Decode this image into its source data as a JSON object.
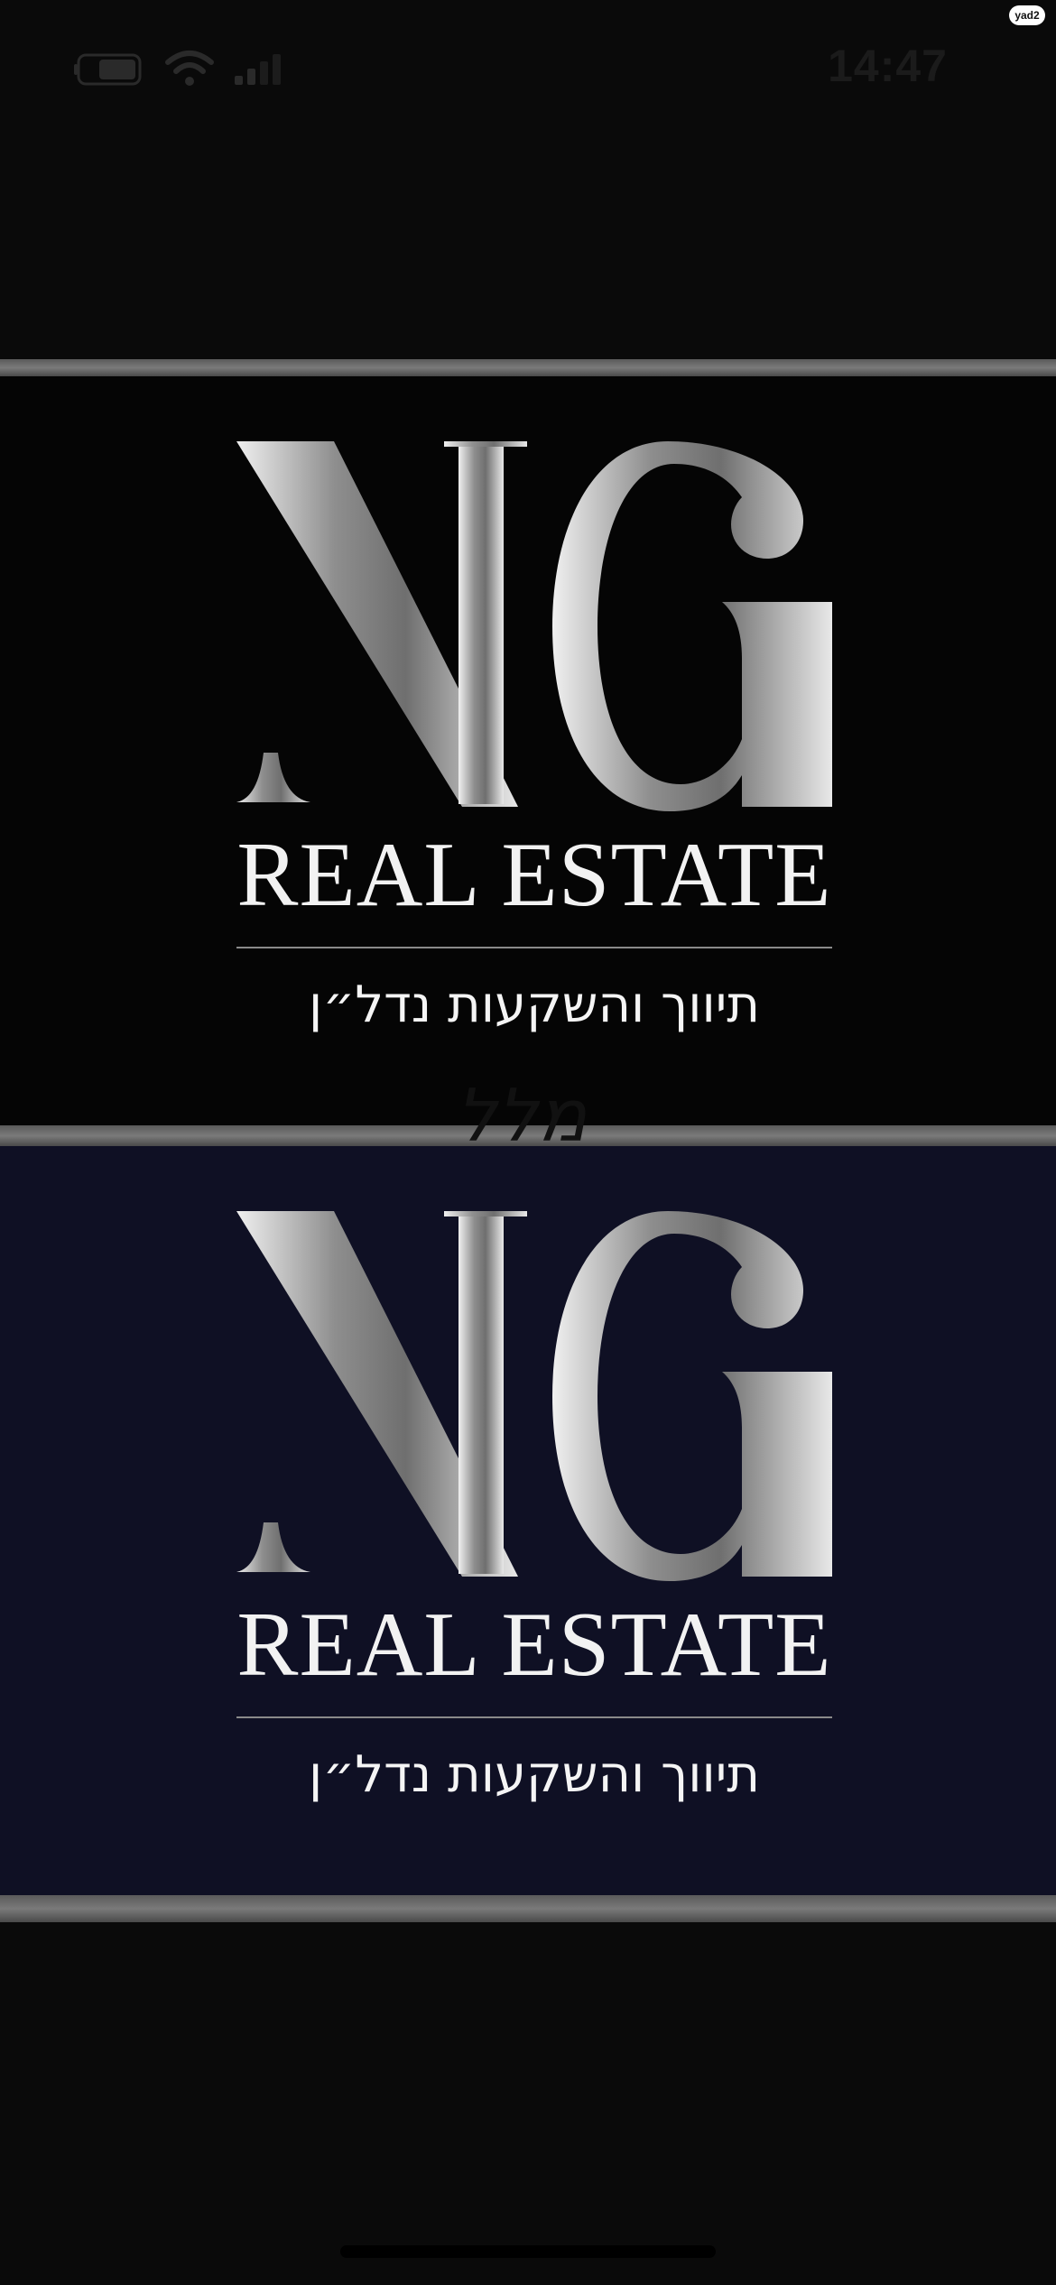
{
  "status_bar": {
    "time": "14:47",
    "watermark": "yad2"
  },
  "banners": [
    {
      "logo_letters": "NG",
      "subtitle": "REAL ESTATE",
      "hebrew": "תיווך והשקעות נדל״ן",
      "background": "#050505"
    },
    {
      "logo_letters": "NG",
      "subtitle": "REAL ESTATE",
      "hebrew": "תיווך והשקעות נדל״ן",
      "background": "#0f1024"
    }
  ],
  "overlay": {
    "text": "מלל"
  },
  "colors": {
    "page_background": "#0a0a0a",
    "divider": "#6a6a6a",
    "logo_silver": "#b8b8b8"
  }
}
